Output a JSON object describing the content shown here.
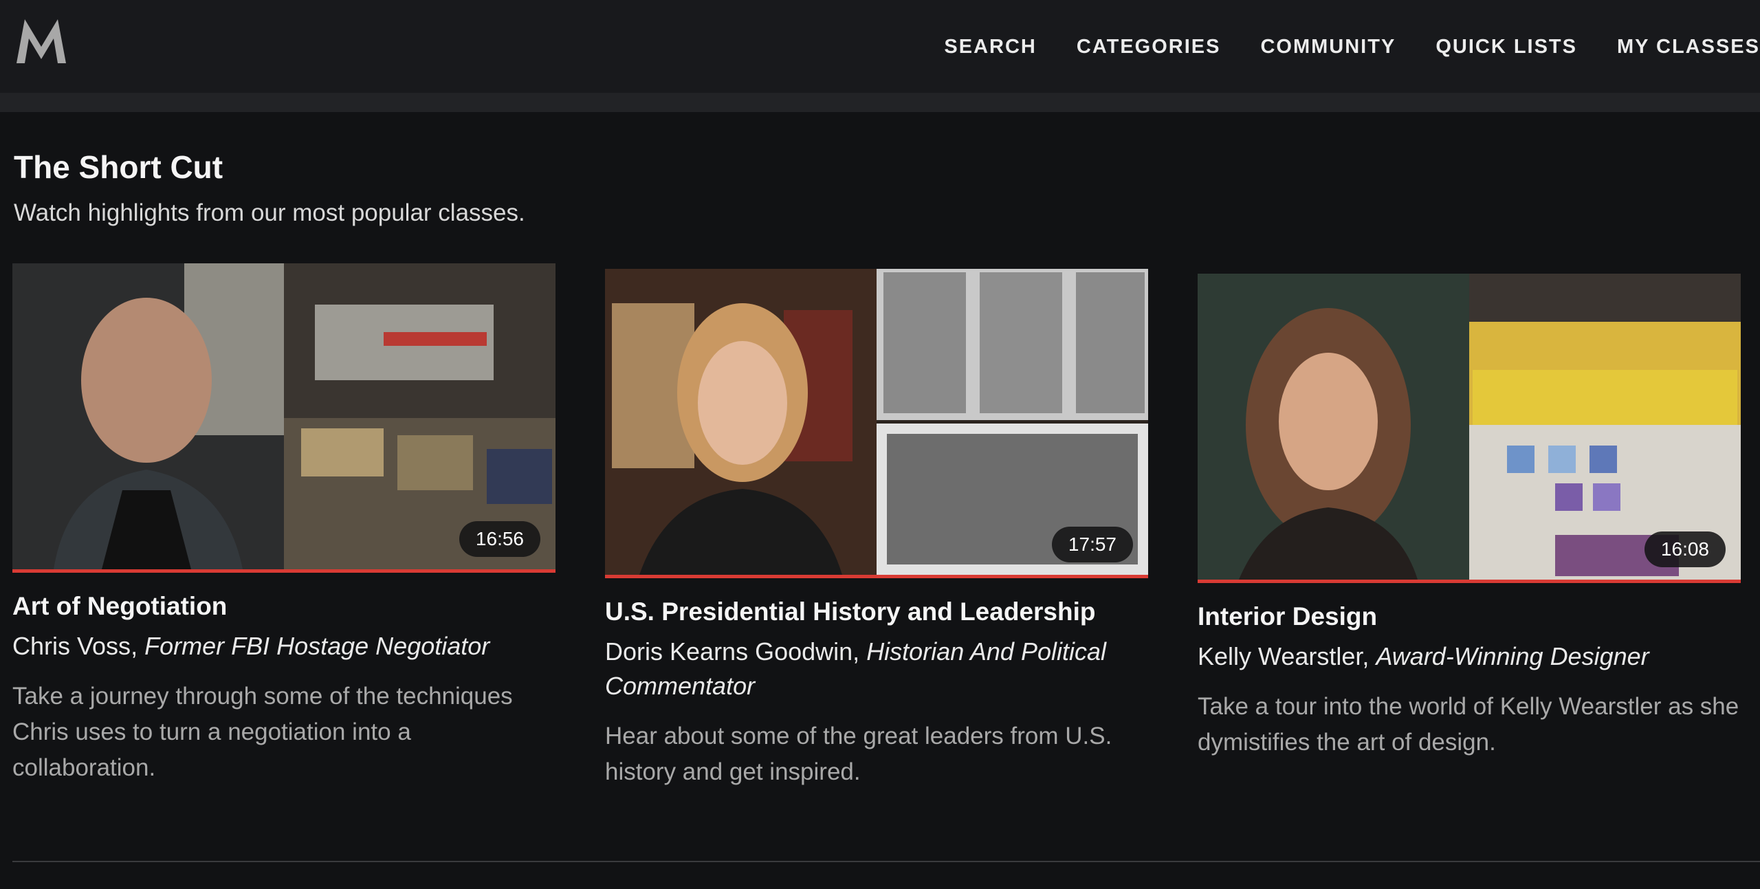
{
  "nav": {
    "items": [
      "SEARCH",
      "CATEGORIES",
      "COMMUNITY",
      "QUICK LISTS",
      "MY CLASSES"
    ]
  },
  "section": {
    "title": "The Short Cut",
    "subtitle": "Watch highlights from our most popular classes."
  },
  "cards": [
    {
      "title": "Art of Negotiation",
      "instructor": "Chris Voss",
      "role": "Former FBI Hostage Negotiator",
      "description": "Take a journey through some of the techniques Chris uses to turn a negotiation into a collaboration.",
      "duration": "16:56"
    },
    {
      "title": "U.S. Presidential History and Leadership",
      "instructor": "Doris Kearns Goodwin",
      "role": "Historian And Political Commentator",
      "description": "Hear about some of the great leaders from U.S. history and get inspired.",
      "duration": "17:57"
    },
    {
      "title": "Interior Design",
      "instructor": "Kelly Wearstler",
      "role": "Award-Winning Designer",
      "description": "Take a tour into the world of Kelly Wearstler as she dymistifies the art of design.",
      "duration": "16:08"
    }
  ],
  "colors": {
    "background": "#111214",
    "accent": "#d93b34"
  }
}
